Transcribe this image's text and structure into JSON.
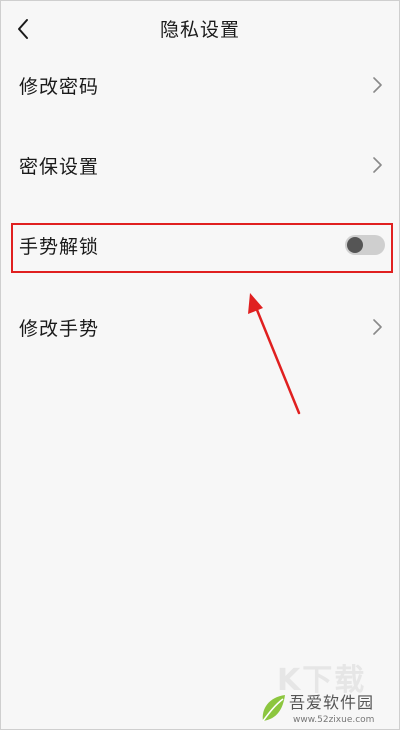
{
  "header": {
    "title": "隐私设置",
    "back_icon": "chevron-left-icon"
  },
  "settings": [
    {
      "label": "修改密码",
      "control": "chevron"
    },
    {
      "label": "密保设置",
      "control": "chevron"
    },
    {
      "label": "手势解锁",
      "control": "toggle",
      "toggle_on": false
    },
    {
      "label": "修改手势",
      "control": "chevron"
    }
  ],
  "annotation": {
    "highlight_color": "#e02020",
    "target": "手势解锁"
  },
  "watermark": {
    "brand": "吾爱软件园",
    "url": "www.52zixue.com",
    "ghost_text": "K下载"
  },
  "colors": {
    "background": "#f7f7f7",
    "text": "#1a1a1a",
    "toggle_off_track": "#cfcfcf",
    "toggle_knob": "#555555",
    "annotation_red": "#e02020"
  }
}
